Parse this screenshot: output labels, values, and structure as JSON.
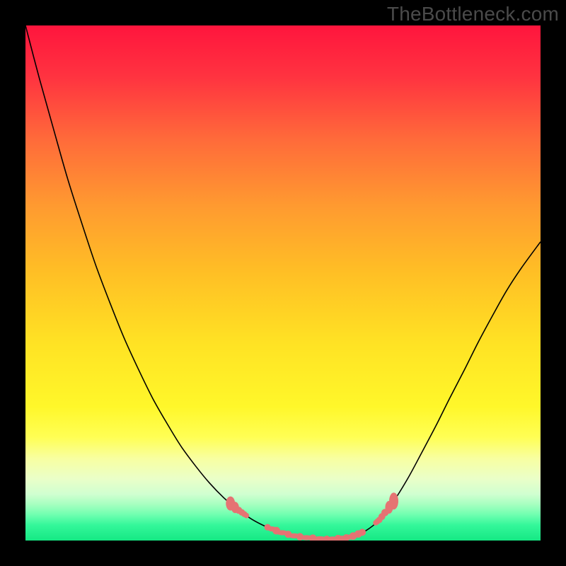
{
  "watermark": "TheBottleneck.com",
  "colors": {
    "marker": "#e57373",
    "curve": "#000000",
    "frame": "#000000"
  },
  "chart_data": {
    "type": "line",
    "title": "",
    "xlabel": "",
    "ylabel": "",
    "xlim": [
      0,
      1
    ],
    "ylim": [
      0,
      1
    ],
    "x": [
      0.0,
      0.027,
      0.055,
      0.082,
      0.11,
      0.137,
      0.165,
      0.192,
      0.22,
      0.247,
      0.275,
      0.302,
      0.33,
      0.357,
      0.385,
      0.412,
      0.44,
      0.467,
      0.495,
      0.522,
      0.549,
      0.577,
      0.604,
      0.632,
      0.659,
      0.687,
      0.714,
      0.742,
      0.769,
      0.797,
      0.824,
      0.852,
      0.879,
      0.907,
      0.934,
      0.962,
      1.0
    ],
    "y": [
      1.0,
      0.897,
      0.797,
      0.702,
      0.614,
      0.533,
      0.459,
      0.392,
      0.331,
      0.276,
      0.227,
      0.183,
      0.145,
      0.112,
      0.083,
      0.06,
      0.041,
      0.027,
      0.016,
      0.009,
      0.005,
      0.003,
      0.003,
      0.007,
      0.018,
      0.04,
      0.075,
      0.12,
      0.17,
      0.223,
      0.277,
      0.331,
      0.385,
      0.437,
      0.485,
      0.528,
      0.58
    ],
    "left_markers_x": [
      0.398,
      0.407,
      0.414,
      0.42,
      0.425,
      0.429
    ],
    "right_markers_x": [
      0.715,
      0.706,
      0.698,
      0.692,
      0.687,
      0.683,
      0.68
    ],
    "floor_markers_x": [
      0.47,
      0.487,
      0.51,
      0.533,
      0.558,
      0.585,
      0.607,
      0.623,
      0.636,
      0.646,
      0.654
    ]
  }
}
